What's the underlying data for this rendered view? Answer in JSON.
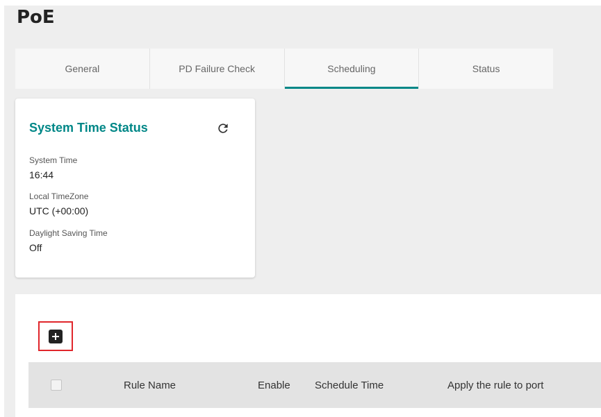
{
  "page": {
    "title": "PoE"
  },
  "tabs": [
    {
      "label": "General",
      "active": false
    },
    {
      "label": "PD Failure Check",
      "active": false
    },
    {
      "label": "Scheduling",
      "active": true
    },
    {
      "label": "Status",
      "active": false
    }
  ],
  "time_status": {
    "title": "System Time Status",
    "refresh_icon": "refresh-icon",
    "system_time_label": "System Time",
    "system_time_value": "16:44",
    "timezone_label": "Local TimeZone",
    "timezone_value": "UTC (+00:00)",
    "dst_label": "Daylight Saving Time",
    "dst_value": "Off"
  },
  "rules": {
    "add_icon": "add-icon",
    "columns": [
      "Rule Name",
      "Enable",
      "Schedule Time",
      "Apply the rule to port"
    ]
  },
  "colors": {
    "accent": "#008787",
    "highlight": "#e0262b",
    "background": "#eeeeee"
  }
}
